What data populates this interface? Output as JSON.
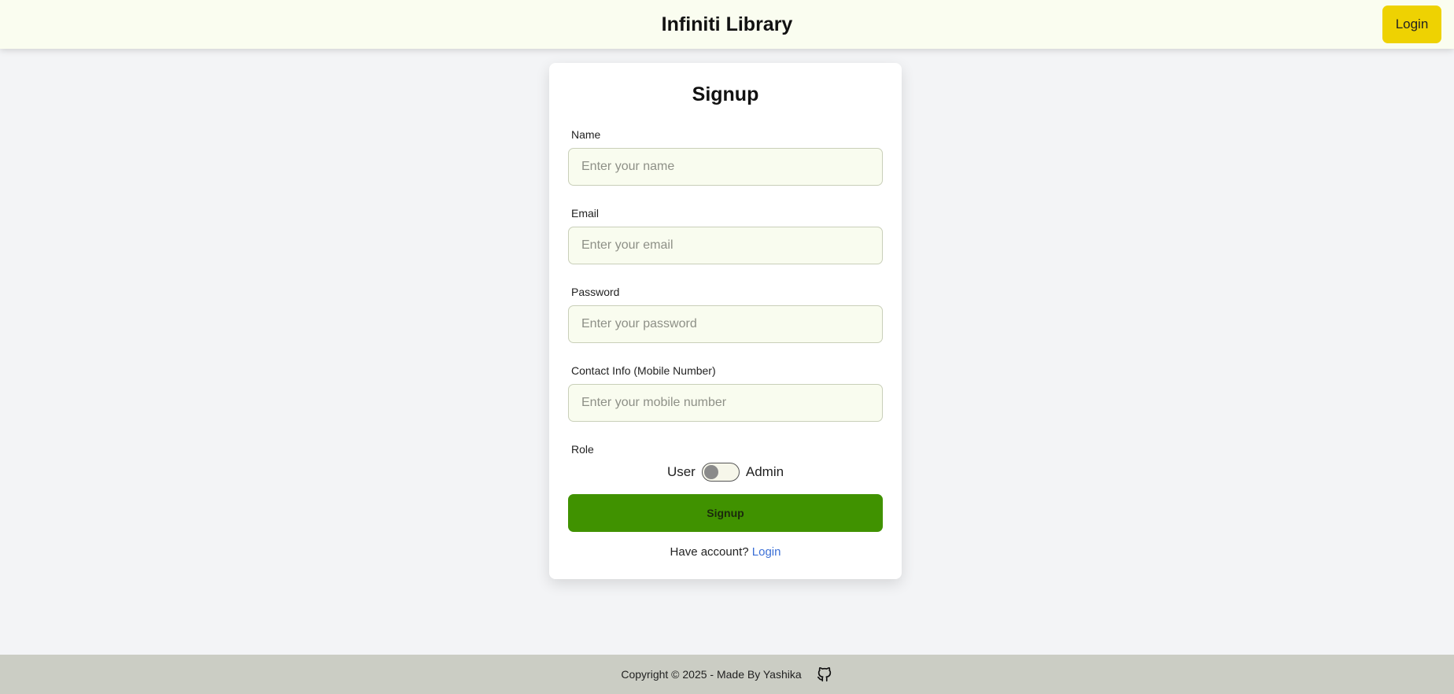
{
  "header": {
    "title": "Infiniti Library",
    "login_label": "Login"
  },
  "form": {
    "title": "Signup",
    "fields": [
      {
        "label": "Name",
        "placeholder": "Enter your name",
        "value": ""
      },
      {
        "label": "Email",
        "placeholder": "Enter your email",
        "value": ""
      },
      {
        "label": "Password",
        "placeholder": "Enter your password",
        "value": ""
      },
      {
        "label": "Contact Info (Mobile Number)",
        "placeholder": "Enter your mobile number",
        "value": ""
      }
    ],
    "role": {
      "label": "Role",
      "left_option": "User",
      "right_option": "Admin",
      "selected": "User"
    },
    "submit_label": "Signup",
    "have_account_text": "Have account?",
    "login_link": "Login"
  },
  "footer": {
    "copyright": "Copyright © 2025 - Made By Yashika",
    "icon": "github-icon"
  },
  "colors": {
    "header_bg": "#fafdf0",
    "login_button": "#eed202",
    "signup_button": "#409200",
    "link": "#3b6fd6",
    "footer_bg": "#cbcdc4",
    "page_bg": "#f3f4f6"
  }
}
